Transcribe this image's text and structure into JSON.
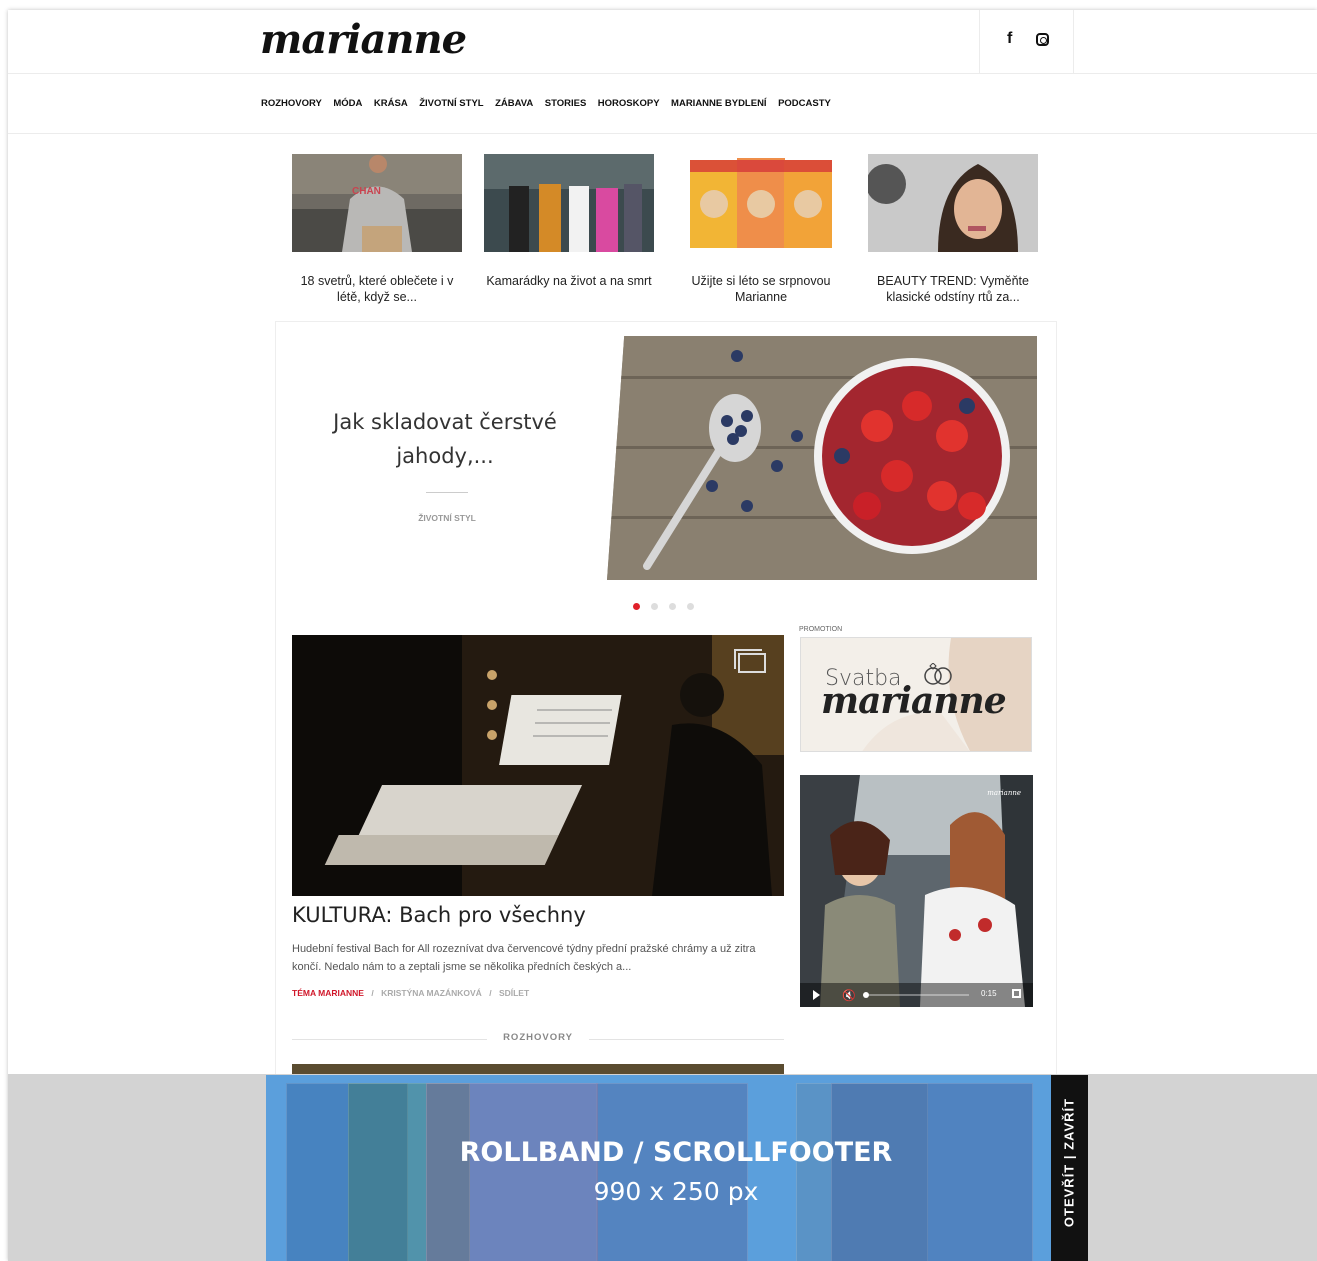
{
  "header": {
    "logo": "marianne"
  },
  "nav": {
    "items": [
      "ROZHOVORY",
      "MÓDA",
      "KRÁSA",
      "ŽIVOTNÍ STYL",
      "ZÁBAVA",
      "STORIES",
      "HOROSKOPY",
      "MARIANNE BYDLENÍ",
      "PODCASTY"
    ]
  },
  "teasers": [
    {
      "title": "18 svetrů, které oblečete i v létě, když se..."
    },
    {
      "title": "Kamarádky na život a na smrt"
    },
    {
      "title": "Užijte si léto se srpnovou Marianne"
    },
    {
      "title": "BEAUTY TREND: Vyměňte klasické odstíny rtů za..."
    }
  ],
  "slider": {
    "title": "Jak skladovat čerstvé jahody,...",
    "category": "ŽIVOTNÍ STYL",
    "slide_count": 4,
    "active_index": 0
  },
  "main_article": {
    "title": "KULTURA: Bach pro všechny",
    "perex": "Hudební festival Bach for All rozeznívat dva červencové týdny přední pražské chrámy a už zitra končí. Nedalo nám to a zeptali jsme se několika předních českých a...",
    "meta": {
      "tag": "TÉMA MARIANNE",
      "author": "KRISTÝNA MAZÁNKOVÁ",
      "action": "SDÍLET",
      "separator": "/"
    }
  },
  "section": {
    "label": "ROZHOVORY"
  },
  "sidebar": {
    "promo_label": "PROMOTION",
    "promo_line1": "Svatba",
    "promo_line2": "marianne",
    "video_logo": "marianne",
    "video_time": "0:15"
  },
  "rollband": {
    "title": "ROLLBAND / SCROLLFOOTER",
    "size": "990 x 250 px",
    "tab_label": "OTEVŘÍT | ZAVŘÍT"
  },
  "colors": {
    "accent": "#e0202a",
    "rollband": "#5b9fdc"
  }
}
